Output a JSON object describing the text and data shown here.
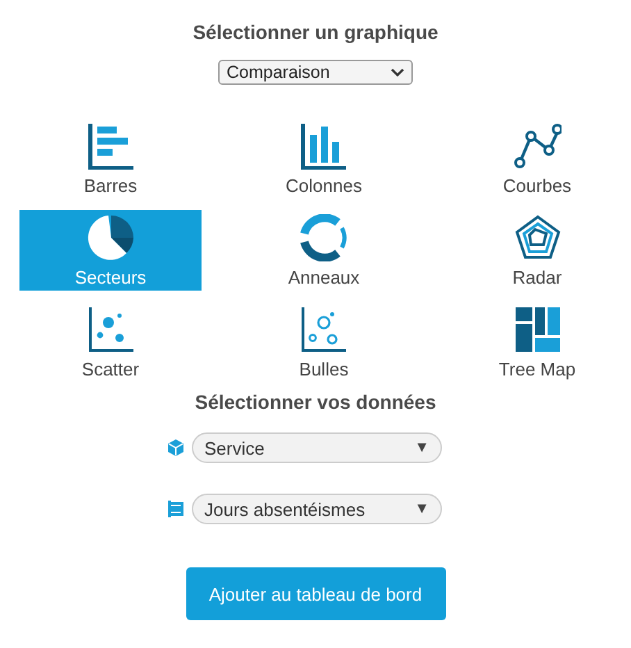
{
  "chart_section": {
    "title": "Sélectionner un graphique",
    "category_select": {
      "value": "Comparaison"
    },
    "chart_types": [
      {
        "label": "Barres",
        "kind": "bar",
        "selected": false
      },
      {
        "label": "Colonnes",
        "kind": "column",
        "selected": false
      },
      {
        "label": "Courbes",
        "kind": "line",
        "selected": false
      },
      {
        "label": "Secteurs",
        "kind": "pie",
        "selected": true
      },
      {
        "label": "Anneaux",
        "kind": "donut",
        "selected": false
      },
      {
        "label": "Radar",
        "kind": "radar",
        "selected": false
      },
      {
        "label": "Scatter",
        "kind": "scatter",
        "selected": false
      },
      {
        "label": "Bulles",
        "kind": "bubble",
        "selected": false
      },
      {
        "label": "Tree Map",
        "kind": "treemap",
        "selected": false
      }
    ]
  },
  "data_section": {
    "title": "Sélectionner vos données",
    "fields": [
      {
        "kind": "dimension",
        "value": "Service",
        "arrow": "▼"
      },
      {
        "kind": "measure",
        "value": "Jours absentéismes",
        "arrow": "▼"
      }
    ]
  },
  "add_button": {
    "label": "Ajouter au tableau de bord"
  }
}
